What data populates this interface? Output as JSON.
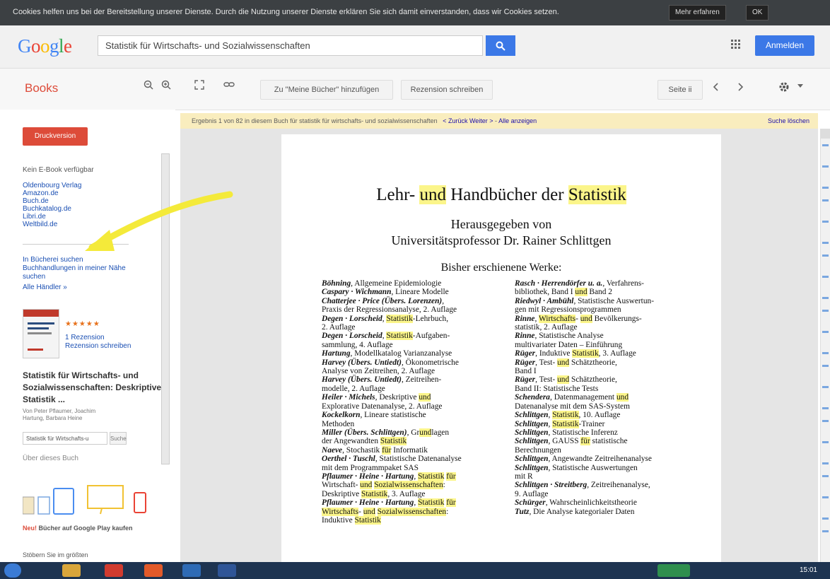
{
  "cookie_bar": {
    "text": "Cookies helfen uns bei der Bereitstellung unserer Dienste. Durch die Nutzung unserer Dienste erklären Sie sich damit einverstanden, dass wir Cookies setzen.",
    "more_label": "Mehr erfahren",
    "ok_label": "OK"
  },
  "header": {
    "logo": "Google",
    "search_value": "Statistik für Wirtschafts- und Sozialwissenschaften",
    "signin_label": "Anmelden"
  },
  "toolbar": {
    "books_label": "Books",
    "add_to_library_label": "Zu \"Meine Bücher\" hinzufügen",
    "write_review_label": "Rezension schreiben",
    "page_label": "Seite ii"
  },
  "notice": {
    "text": "Ergebnis 1 von 82 in diesem Buch für statistik für wirtschafts- und sozialwissenschaften",
    "back_next": "< Zurück Weiter >",
    "show_all": "Alle anzeigen",
    "search_link": "Suche löschen"
  },
  "sidebar": {
    "buy_label": "Druckversion",
    "no_ebook": "Kein E-Book verfügbar",
    "sellers": [
      "Oldenbourg Verlag",
      "Amazon.de",
      "Buch.de",
      "Buchkatalog.de",
      "Libri.de",
      "Weltbild.de"
    ],
    "library_links": [
      "In Bücherei suchen",
      "Buchhandlungen in meiner Nähe",
      "suchen",
      "Alle Händler »"
    ],
    "rating_count_link": "1 Rezension",
    "write_review_link": "Rezension schreiben",
    "book_title": "Statistik für Wirtschafts- und Sozialwissenschaften: Deskriptive Statistik ...",
    "authors": [
      "Von Peter Pflaumer, Joachim",
      "Hartung, Barbara Heine"
    ],
    "search_value": "Statistik für Wirtschafts-u",
    "search_button": "Suche",
    "about_link": "Über dieses Buch",
    "play_promo_new": "Neu!",
    "play_promo": "Bücher auf Google Play kaufen",
    "play_desc": "Stöbern Sie im größten"
  },
  "page": {
    "title_parts": [
      "Lehr- ",
      "und",
      " Handbücher der ",
      "Statistik"
    ],
    "subtitle1": "Herausgegeben von",
    "subtitle2": "Universitätsprofessor Dr. Rainer Schlittgen",
    "subtitle3": "Bisher erschienene Werke:",
    "left_column": [
      "Böhning, Allgemeine Epidemiologie",
      "Caspary · Wichmann, Lineare Modelle",
      "Chatterjee · Price (Übers. Lorenzen),",
      "Praxis der Regressionsanalyse, 2. Auflage",
      "Degen · Lorscheid, Statistik-Lehrbuch,",
      "2. Auflage",
      "Degen · Lorscheid, Statistik-Aufgaben-",
      "sammlung, 4. Auflage",
      "Hartung, Modellkatalog Varianzanalyse",
      "Harvey (Übers. Untiedt), Ökonometrische",
      "Analyse von Zeitreihen, 2. Auflage",
      "Harvey (Übers. Untiedt), Zeitreihen-",
      "modelle, 2. Auflage",
      "Heiler · Michels, Deskriptive und",
      "Explorative Datenanalyse, 2. Auflage",
      "Kockelkorn, Lineare statistische",
      "Methoden",
      "Miller (Übers. Schlittgen), Grundlagen",
      "der Angewandten Statistik",
      "Naeve, Stochastik für Informatik",
      "Oerthel · Tuschl, Statistische Datenanalyse",
      "mit dem Programmpaket SAS",
      "Pflaumer · Heine · Hartung, Statistik für",
      "Wirtschaft- und Sozialwissenschaften:",
      "Deskriptive Statistik, 3. Auflage",
      "Pflaumer · Heine · Hartung, Statistik für",
      "Wirtschafts- und Sozialwissenschaften:",
      "Induktive Statistik"
    ],
    "right_column": [
      "Rasch · Herrendörfer u. a., Verfahrens-",
      "bibliothek, Band I und Band 2",
      "Riedwyl · Ambühl, Statistische Auswertun-",
      "gen mit Regressionsprogrammen",
      "Rinne, Wirtschafts- und Bevölkerungs-",
      "statistik, 2. Auflage",
      "Rinne, Statistische Analyse",
      "multivariater Daten – Einführung",
      "Rüger, Induktive Statistik, 3. Auflage",
      "Rüger, Test- und Schätztheorie,",
      "Band I",
      "Rüger, Test- und Schätztheorie,",
      "Band II: Statistische Tests",
      "Schendera, Datenmanagement und",
      "Datenanalyse mit dem SAS-System",
      "Schlittgen, Statistik, 10. Auflage",
      "Schlittgen, Statistik-Trainer",
      "Schlittgen, Statistische Inferenz",
      "Schlittgen, GAUSS für statistische",
      "Berechnungen",
      "Schlittgen, Angewandte Zeitreihenanalyse",
      "Schlittgen, Statistische Auswertungen",
      "mit R",
      "Schlittgen · Streitberg, Zeitreihenanalyse,",
      "9. Auflage",
      "Schürger, Wahrscheinlichkeitstheorie",
      "Tutz, Die Analyse kategorialer Daten"
    ]
  },
  "taskbar": {
    "clock": "15:01"
  }
}
